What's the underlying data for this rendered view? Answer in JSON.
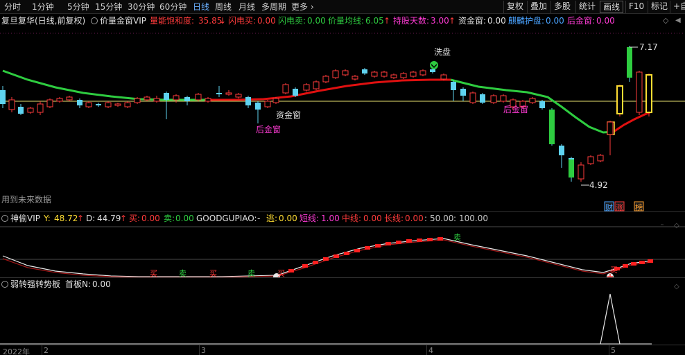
{
  "toolbar": {
    "periods": [
      "分时",
      "1分钟",
      "5分钟",
      "15分钟",
      "30分钟",
      "60分钟",
      "日线",
      "周线",
      "月线",
      "多周期",
      "更多 ›"
    ],
    "active_period": "日线",
    "right_buttons": [
      "复权",
      "叠加",
      "多股",
      "统计",
      "画线",
      "F10",
      "标记",
      "+自"
    ],
    "boxed_button": "画线"
  },
  "main_panel": {
    "stock_title": "复旦复华(日线,前复权)",
    "indicator_name": "价量金窗VIP",
    "items": [
      {
        "label": "量能饱和度:",
        "value": "35.85",
        "arrow": "↓",
        "color": "#ff3b3b"
      },
      {
        "label": "闪电买:",
        "value": "0.00",
        "color": "#ff3b3b"
      },
      {
        "label": "闪电卖:",
        "value": "0.00",
        "color": "#2ecc40"
      },
      {
        "label": "价量均线:",
        "value": "6.05",
        "arrow": "↑",
        "color": "#2ecc40"
      },
      {
        "label": "持股天数:",
        "value": "3.00",
        "arrow": "↑",
        "color": "#ff3bd5"
      },
      {
        "label": "资金窗:",
        "value": "0.00",
        "color": "#e0e0e0"
      },
      {
        "label": "麒麟护盘:",
        "value": "0.00",
        "color": "#4aa3ff"
      },
      {
        "label": "后金窗:",
        "value": "0.00",
        "color": "#ff3bd5"
      }
    ],
    "annotations": {
      "wash": "洗盘",
      "fund_window": "资金窗",
      "late_gold_1": "后金窗",
      "late_gold_2": "后金窗",
      "high": "7.17",
      "low": "4.92",
      "future_data": "用到未来数据",
      "badges": [
        "财",
        "涨",
        "榜"
      ]
    }
  },
  "sub_panel_1": {
    "name": "神偷VIP",
    "items": [
      {
        "label": "Y:",
        "value": "48.72",
        "arrow": "↑",
        "color": "#ffdd33"
      },
      {
        "label": "D:",
        "value": "44.79",
        "arrow": "↑",
        "color": "#e0e0e0"
      },
      {
        "label": "买:",
        "value": "0.00",
        "color": "#ff3b3b"
      },
      {
        "label": "卖:",
        "value": "0.00",
        "color": "#2ecc40"
      },
      {
        "label": "GOODGUPIAO:",
        "value": "-",
        "color": "#e0e0e0"
      },
      {
        "label": "逃:",
        "value": "0.00",
        "color": "#ffdd33"
      },
      {
        "label": "短线:",
        "value": "1.00",
        "color": "#ff3bd5"
      },
      {
        "label": "中线:",
        "value": "0.00",
        "color": "#ff3b3b"
      },
      {
        "label": "长线:",
        "value": "0.00",
        "color": "#ff3b3b"
      },
      {
        "label": ":",
        "value": "50.00",
        "color": "#c8c8c8"
      },
      {
        "label": ":",
        "value": "100.00",
        "color": "#c8c8c8"
      }
    ],
    "signals": [
      "买",
      "卖",
      "买",
      "卖",
      "买",
      "卖",
      "买"
    ]
  },
  "sub_panel_2": {
    "name": "弱转强转势板",
    "items": [
      {
        "label": "首板N:",
        "value": "0.00",
        "color": "#e0e0e0"
      }
    ]
  },
  "x_axis": {
    "labels": [
      "2022年",
      "2",
      "3",
      "4",
      "5"
    ]
  },
  "colors": {
    "up": "#ff3b3b",
    "down": "#5fd3f0",
    "ma_green": "#2ecc40",
    "ma_red": "#e01010",
    "ref_line": "#e8e070"
  }
}
